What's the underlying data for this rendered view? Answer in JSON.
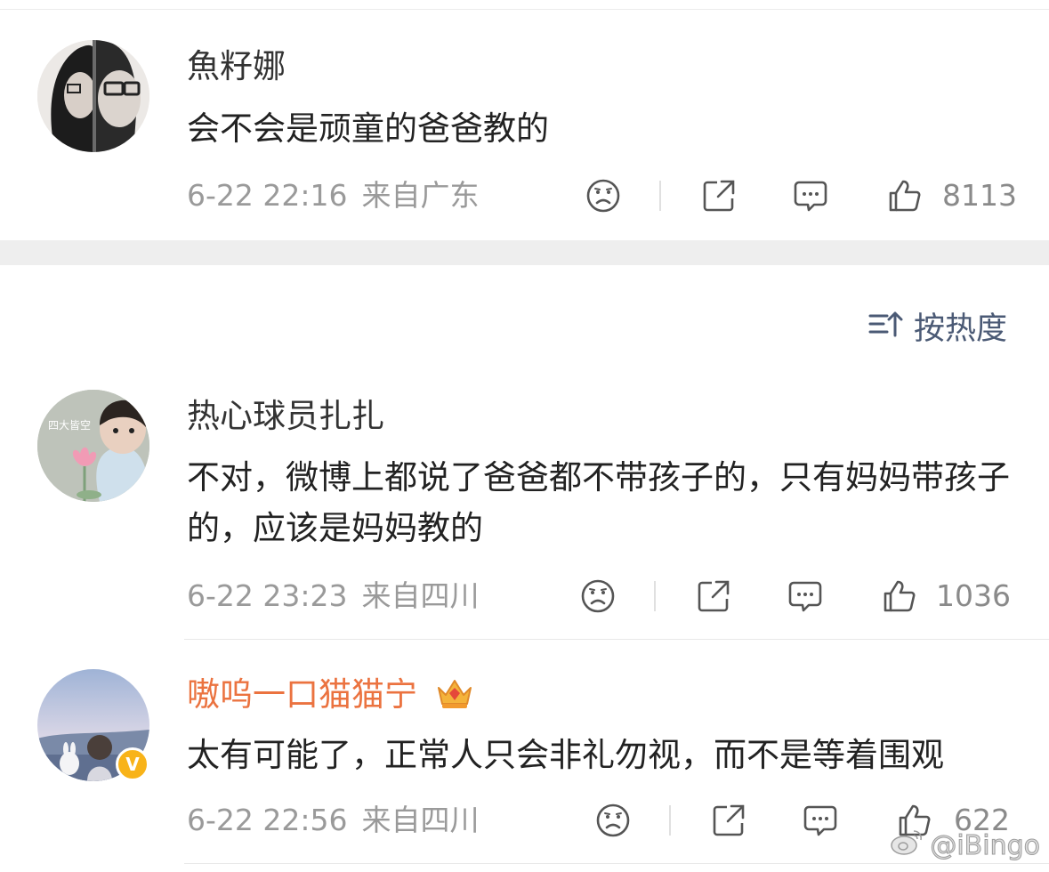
{
  "comments": [
    {
      "username": "魚籽娜",
      "content": "会不会是顽童的爸爸教的",
      "date": "6-22 22:16",
      "location": "来自广东",
      "likes": "8113",
      "icons": [
        "sad-face-icon",
        "share-icon",
        "comment-icon",
        "thumbs-up-icon"
      ]
    },
    {
      "username": "热心球员扎扎",
      "avatar_text": "四大皆空",
      "content": "不对，微博上都说了爸爸都不带孩子的，只有妈妈带孩子的，应该是妈妈教的",
      "date": "6-22 23:23",
      "location": "来自四川",
      "likes": "1036"
    },
    {
      "username": "嗷呜一口猫猫宁",
      "badge": "crown-icon",
      "verified": "V",
      "content": "太有可能了，正常人只会非礼勿视，而不是等着围观",
      "date": "6-22 22:56",
      "location": "来自四川",
      "likes": "622"
    }
  ],
  "sort": {
    "label": "按热度",
    "icon": "sort-icon"
  },
  "watermark": "@iBingo",
  "colors": {
    "vip_name": "#eb7340",
    "sort_text": "#4b5a75",
    "meta": "#9a9a9a"
  }
}
